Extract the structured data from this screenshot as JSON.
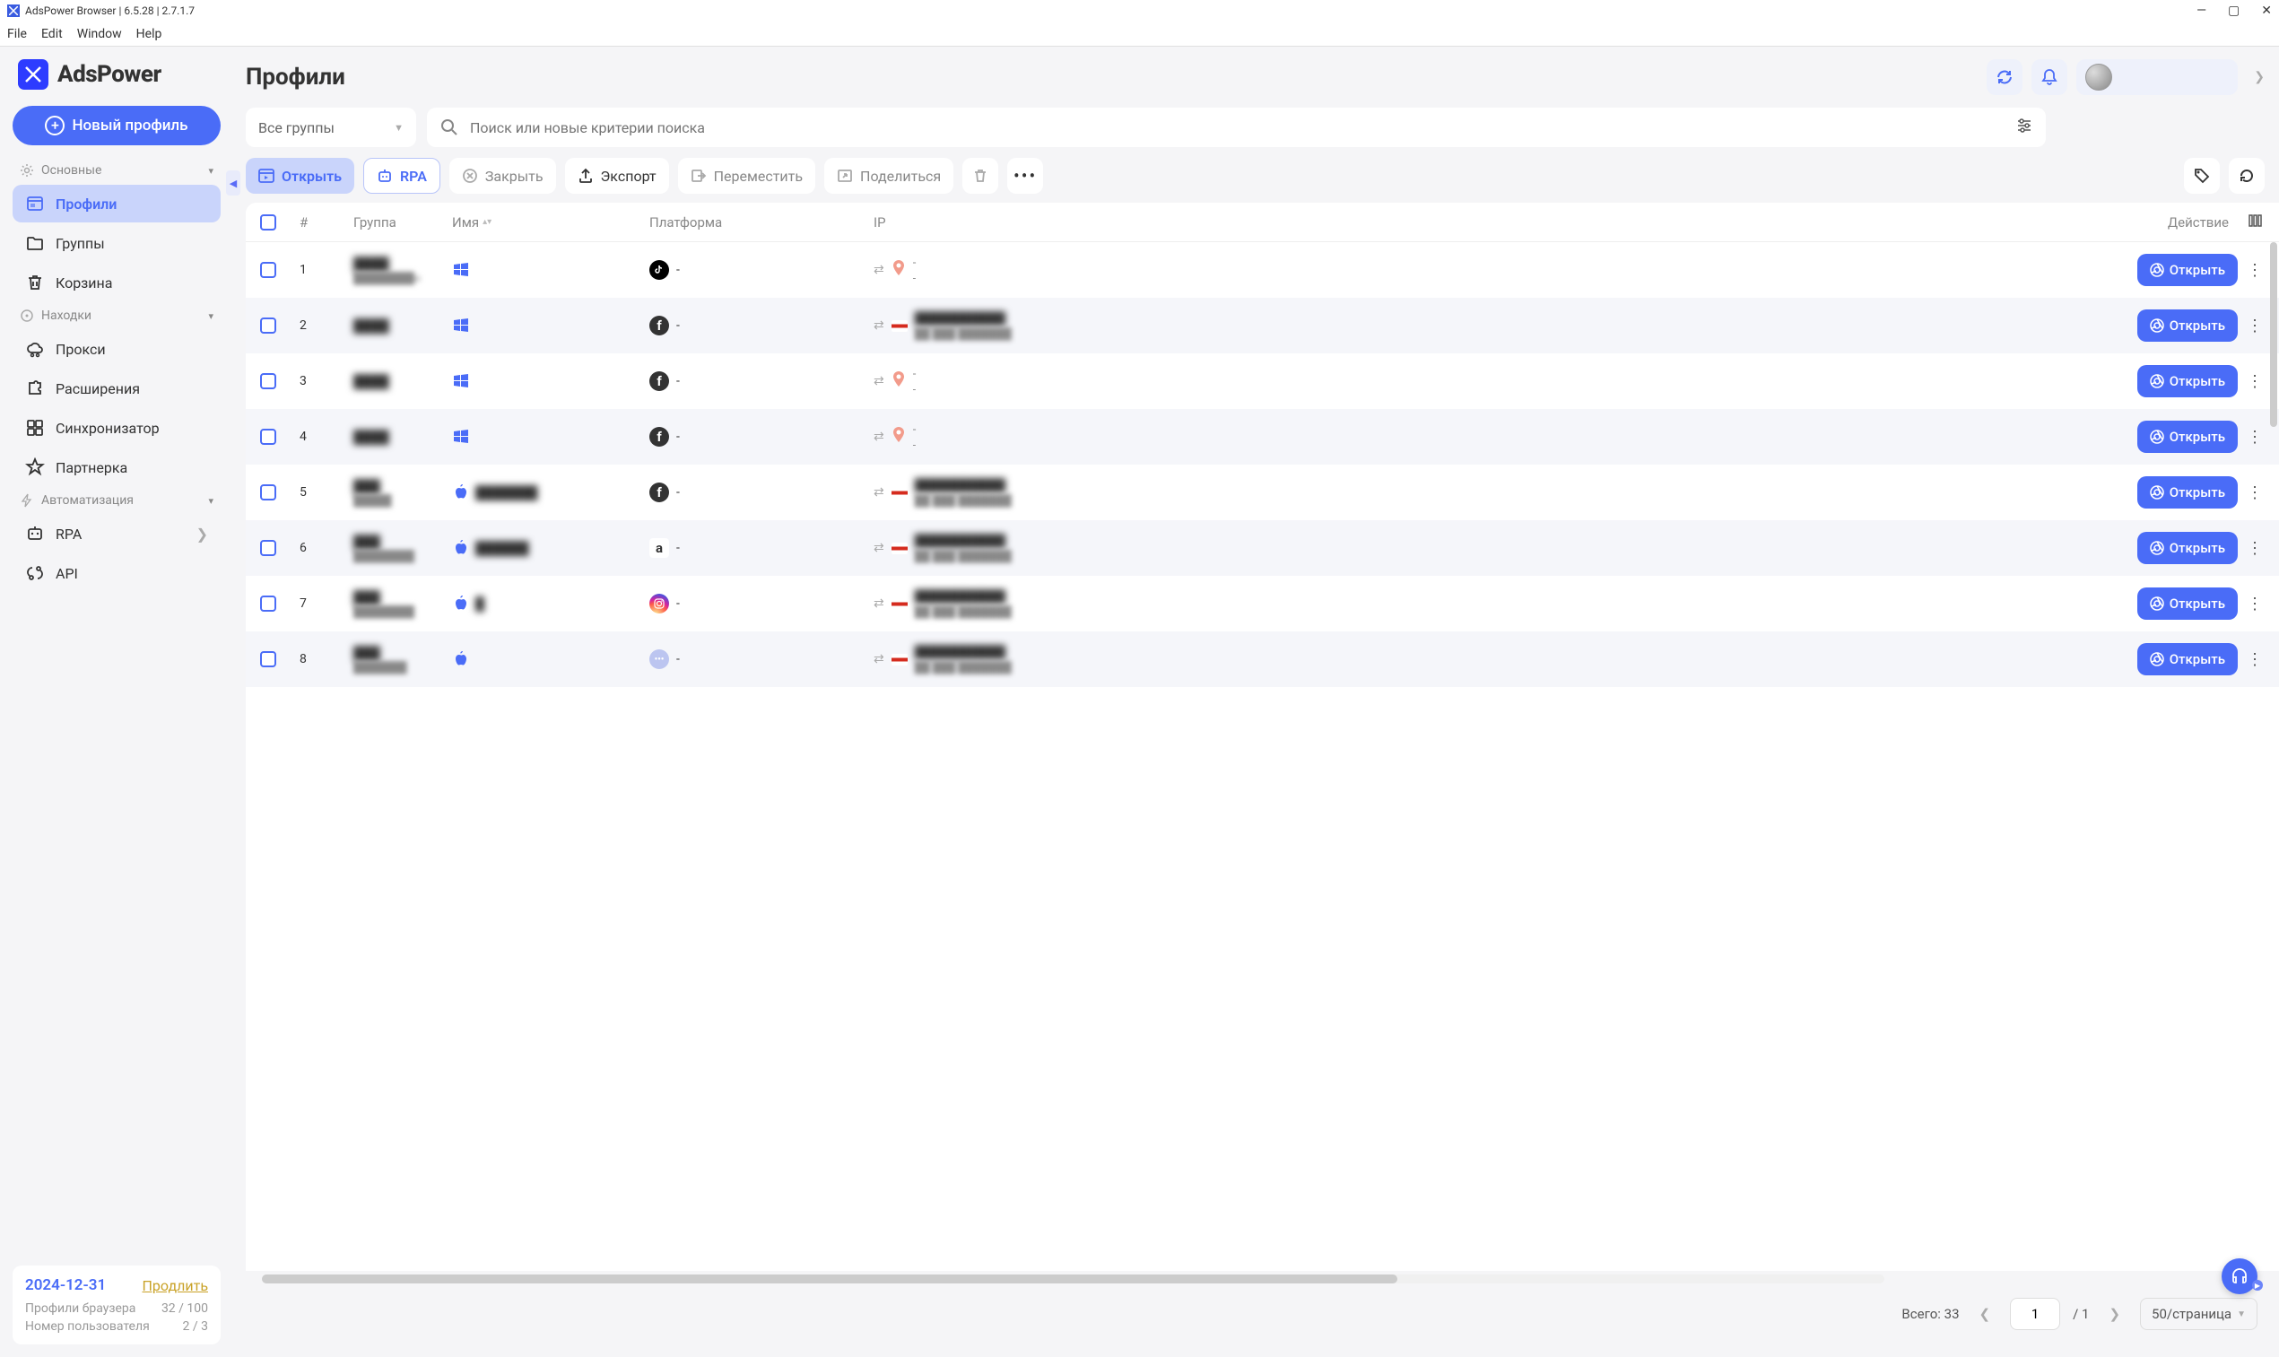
{
  "titlebar": {
    "title": "AdsPower Browser | 6.5.28 | 2.7.1.7"
  },
  "menubar": {
    "file": "File",
    "edit": "Edit",
    "window": "Window",
    "help": "Help"
  },
  "logo": {
    "text": "AdsPower"
  },
  "new_profile_btn": "Новый профиль",
  "sidebar": {
    "section_main": "Основные",
    "items_main": [
      {
        "label": "Профили",
        "icon": "profiles",
        "active": true
      },
      {
        "label": "Группы",
        "icon": "folder"
      },
      {
        "label": "Корзина",
        "icon": "trash"
      }
    ],
    "section_find": "Находки",
    "items_find": [
      {
        "label": "Прокси",
        "icon": "cloud"
      },
      {
        "label": "Расширения",
        "icon": "puzzle"
      },
      {
        "label": "Синхронизатор",
        "icon": "sync"
      },
      {
        "label": "Партнерка",
        "icon": "star"
      }
    ],
    "section_auto": "Автоматизация",
    "items_auto": [
      {
        "label": "RPA",
        "icon": "rpa",
        "chev": true
      },
      {
        "label": "API",
        "icon": "api"
      }
    ]
  },
  "footer": {
    "date": "2024-12-31",
    "extend": "Продлить",
    "stat1_label": "Профили браузера",
    "stat1_value": "32 / 100",
    "stat2_label": "Номер пользователя",
    "stat2_value": "2 / 3"
  },
  "page": {
    "title": "Профили"
  },
  "filters": {
    "group_select": "Все группы",
    "search_placeholder": "Поиск или новые критерии поиска"
  },
  "toolbar": {
    "open": "Открыть",
    "rpa": "RPA",
    "close": "Закрыть",
    "export": "Экспорт",
    "move": "Переместить",
    "share": "Поделиться"
  },
  "table": {
    "headers": {
      "num": "#",
      "group": "Группа",
      "name": "Имя",
      "platform": "Платформа",
      "ip": "IP",
      "action": "Действие"
    },
    "open_label": "Открыть",
    "rows": [
      {
        "num": "1",
        "group": "████",
        "group2": "████████н",
        "os": "windows",
        "name": "",
        "platform": "tiktok",
        "platform_text": "-",
        "ip_mode": "pin",
        "ip_text": "-"
      },
      {
        "num": "2",
        "group": "████",
        "group2": "",
        "os": "windows",
        "name": "",
        "platform": "facebook",
        "platform_text": "-",
        "ip_mode": "flag"
      },
      {
        "num": "3",
        "group": "████",
        "group2": "",
        "os": "windows",
        "name": "",
        "platform": "facebook",
        "platform_text": "-",
        "ip_mode": "pin",
        "ip_text": "-"
      },
      {
        "num": "4",
        "group": "████",
        "group2": "",
        "os": "windows",
        "name": "",
        "platform": "facebook",
        "platform_text": "-",
        "ip_mode": "pin",
        "ip_text": "-"
      },
      {
        "num": "5",
        "group": "███",
        "group2": "█████",
        "os": "apple",
        "name": "███████",
        "platform": "facebook",
        "platform_text": "-",
        "ip_mode": "flag"
      },
      {
        "num": "6",
        "group": "███",
        "group2": "████████",
        "os": "apple",
        "name": "██████",
        "platform": "amazon",
        "platform_text": "-",
        "ip_mode": "flag"
      },
      {
        "num": "7",
        "group": "███",
        "group2": "████████",
        "os": "apple",
        "name": "█",
        "platform": "instagram",
        "platform_text": "-",
        "ip_mode": "flag"
      },
      {
        "num": "8",
        "group": "███",
        "group2": "███████",
        "os": "apple",
        "name": "",
        "platform": "generic",
        "platform_text": "-",
        "ip_mode": "flag"
      }
    ]
  },
  "pagination": {
    "total_label": "Всего:",
    "total": "33",
    "page": "1",
    "pages": "/ 1",
    "size": "50/страница"
  }
}
